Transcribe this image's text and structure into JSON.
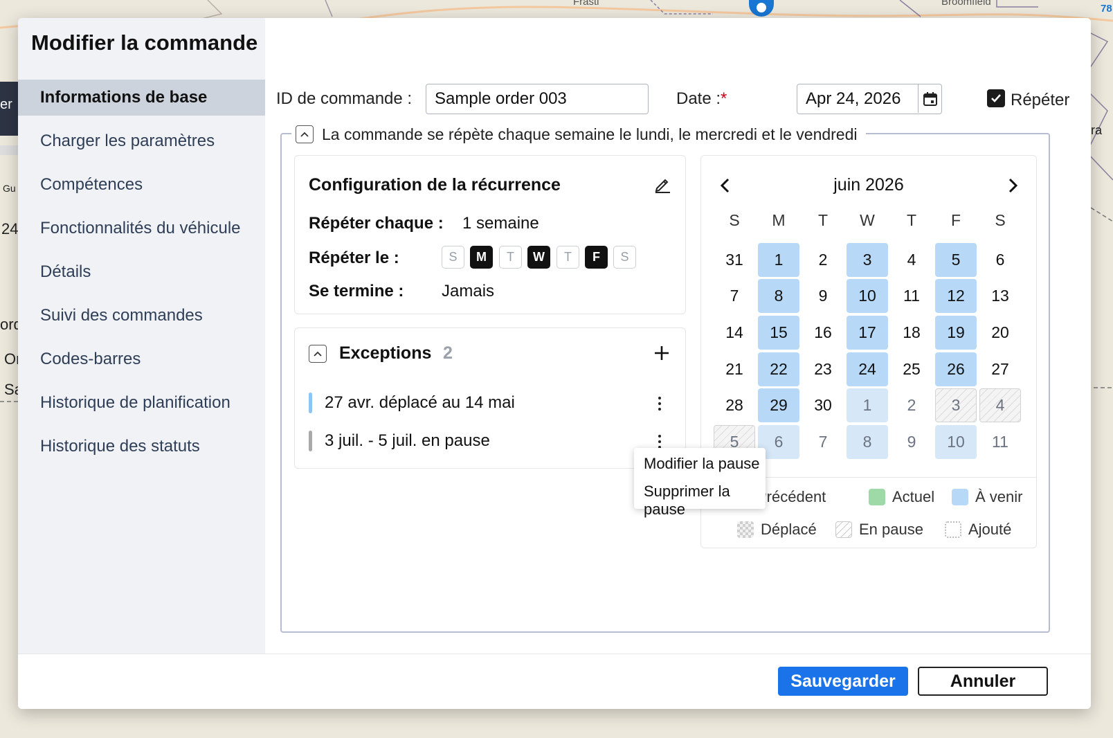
{
  "background": {
    "map_labels": [
      "Frasti",
      "Broomfield",
      "78"
    ],
    "fragments": [
      "er",
      "Gu",
      "24",
      "ord",
      "Or",
      "Sa",
      "ra"
    ]
  },
  "modal": {
    "title": "Modifier la commande",
    "nav": [
      "Informations de base",
      "Charger les paramètres",
      "Compétences",
      "Fonctionnalités du véhicule",
      "Détails",
      "Suivi des commandes",
      "Codes-barres",
      "Historique de planification",
      "Historique des statuts"
    ],
    "active_nav": "Informations de base"
  },
  "form": {
    "order_id_label": "ID de commande :",
    "order_id_value": "Sample order 003",
    "date_label": "Date :",
    "date_required_mark": "*",
    "date_value": "Apr 24, 2026",
    "repeat_label": "Répéter",
    "repeat_checked": true
  },
  "recurrence": {
    "summary": "La commande se répète chaque semaine le lundi, le mercredi et le vendredi",
    "title": "Configuration de la récurrence",
    "repeat_every_label": "Répéter chaque :",
    "repeat_every_value": "1 semaine",
    "repeat_on_label": "Répéter le :",
    "days": [
      {
        "label": "S",
        "on": false
      },
      {
        "label": "M",
        "on": true
      },
      {
        "label": "T",
        "on": false
      },
      {
        "label": "W",
        "on": true
      },
      {
        "label": "T",
        "on": false
      },
      {
        "label": "F",
        "on": true
      },
      {
        "label": "S",
        "on": false
      }
    ],
    "ends_label": "Se termine :",
    "ends_value": "Jamais"
  },
  "exceptions": {
    "title": "Exceptions",
    "count": "2",
    "items": [
      {
        "text": "27 avr. déplacé au 14 mai",
        "color": "#8ec5f2"
      },
      {
        "text": "3 juil. - 5 juil. en pause",
        "color": "#a9a9a9"
      }
    ]
  },
  "context_menu": {
    "items": [
      "Modifier la pause",
      "Supprimer la pause"
    ]
  },
  "calendar": {
    "month": "juin 2026",
    "weekdays": [
      "S",
      "M",
      "T",
      "W",
      "T",
      "F",
      "S"
    ],
    "weeks": [
      [
        {
          "d": "31",
          "s": ""
        },
        {
          "d": "1",
          "s": "u"
        },
        {
          "d": "2",
          "s": ""
        },
        {
          "d": "3",
          "s": "u"
        },
        {
          "d": "4",
          "s": ""
        },
        {
          "d": "5",
          "s": "u"
        },
        {
          "d": "6",
          "s": ""
        }
      ],
      [
        {
          "d": "7",
          "s": ""
        },
        {
          "d": "8",
          "s": "u"
        },
        {
          "d": "9",
          "s": ""
        },
        {
          "d": "10",
          "s": "u"
        },
        {
          "d": "11",
          "s": ""
        },
        {
          "d": "12",
          "s": "u"
        },
        {
          "d": "13",
          "s": ""
        }
      ],
      [
        {
          "d": "14",
          "s": ""
        },
        {
          "d": "15",
          "s": "u"
        },
        {
          "d": "16",
          "s": ""
        },
        {
          "d": "17",
          "s": "u"
        },
        {
          "d": "18",
          "s": ""
        },
        {
          "d": "19",
          "s": "u"
        },
        {
          "d": "20",
          "s": ""
        }
      ],
      [
        {
          "d": "21",
          "s": ""
        },
        {
          "d": "22",
          "s": "u"
        },
        {
          "d": "23",
          "s": ""
        },
        {
          "d": "24",
          "s": "u"
        },
        {
          "d": "25",
          "s": ""
        },
        {
          "d": "26",
          "s": "u"
        },
        {
          "d": "27",
          "s": ""
        }
      ],
      [
        {
          "d": "28",
          "s": ""
        },
        {
          "d": "29",
          "s": "u"
        },
        {
          "d": "30",
          "s": ""
        },
        {
          "d": "1",
          "s": "ul"
        },
        {
          "d": "2",
          "s": "m"
        },
        {
          "d": "3",
          "s": "p"
        },
        {
          "d": "4",
          "s": "p"
        }
      ],
      [
        {
          "d": "5",
          "s": "p"
        },
        {
          "d": "6",
          "s": "ul"
        },
        {
          "d": "7",
          "s": "m"
        },
        {
          "d": "8",
          "s": "ul"
        },
        {
          "d": "9",
          "s": "m"
        },
        {
          "d": "10",
          "s": "ul"
        },
        {
          "d": "11",
          "s": "m"
        }
      ]
    ],
    "legend": [
      {
        "label": "Précédent",
        "kind": "previous"
      },
      {
        "label": "Actuel",
        "kind": "current",
        "color": "#9ed9a8"
      },
      {
        "label": "À venir",
        "kind": "upcoming",
        "color": "#b7d9f7"
      },
      {
        "label": "Déplacé",
        "kind": "moved"
      },
      {
        "label": "En pause",
        "kind": "paused"
      },
      {
        "label": "Ajouté",
        "kind": "added"
      }
    ]
  },
  "footer": {
    "save": "Sauvegarder",
    "cancel": "Annuler"
  },
  "colors": {
    "primary": "#1a73e8",
    "upcoming": "#b7d9f7",
    "current": "#9ed9a8"
  }
}
